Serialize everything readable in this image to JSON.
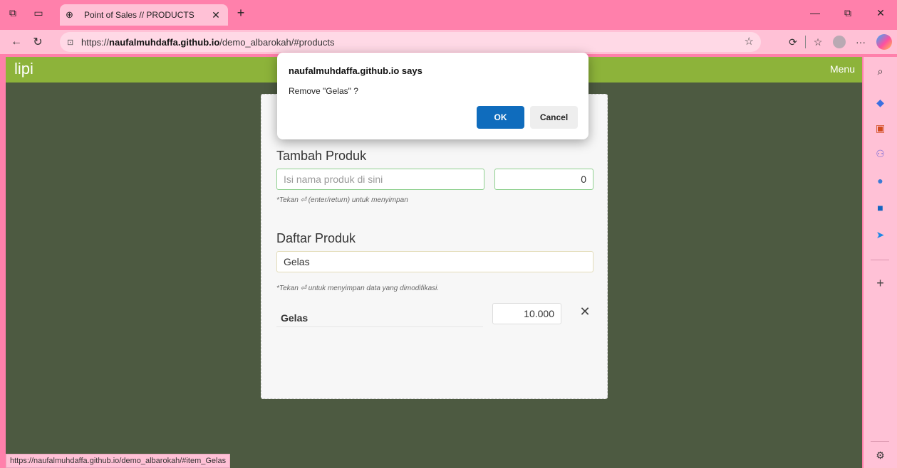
{
  "browser": {
    "tab_title": "Point of Sales // PRODUCTS",
    "url_prefix": "https://",
    "url_host": "naufalmuhdaffa.github.io",
    "url_path": "/demo_albarokah/#products",
    "status_url": "https://naufalmuhdaffa.github.io/demo_albarokah/#item_Gelas",
    "theme_color": "#ff80ab"
  },
  "app": {
    "brand": "lipi",
    "menu_label": "Menu",
    "header_color": "#8db33a",
    "background_color": "#4d5a41"
  },
  "add_product": {
    "title": "Tambah Produk",
    "name_placeholder": "Isi nama produk di sini",
    "price_value": "0",
    "hint": "*Tekan ⏎ (enter/return) untuk menyimpan"
  },
  "product_list": {
    "title": "Daftar Produk",
    "search_value": "Gelas",
    "hint": "*Tekan ⏎ untuk menyimpan data yang dimodifikasi.",
    "items": [
      {
        "name": "Gelas",
        "price": "10.000"
      }
    ]
  },
  "dialog": {
    "title": "naufalmuhdaffa.github.io says",
    "message": "Remove \"Gelas\" ?",
    "ok_label": "OK",
    "cancel_label": "Cancel"
  }
}
